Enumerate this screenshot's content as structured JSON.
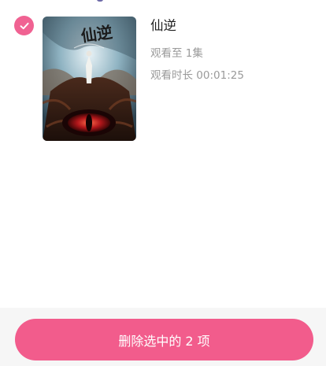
{
  "colors": {
    "accent": "#f25c8c",
    "checkbox": "#f06292"
  },
  "history": {
    "items": [
      {
        "selected": true,
        "check_icon": "checkmark-icon",
        "poster_title_art": "仙逆",
        "title": "仙逆",
        "episode_text": "观看至 1集",
        "duration_text": "观看时长 00:01:25"
      }
    ]
  },
  "footer": {
    "delete_label": "删除选中的 2 项"
  }
}
